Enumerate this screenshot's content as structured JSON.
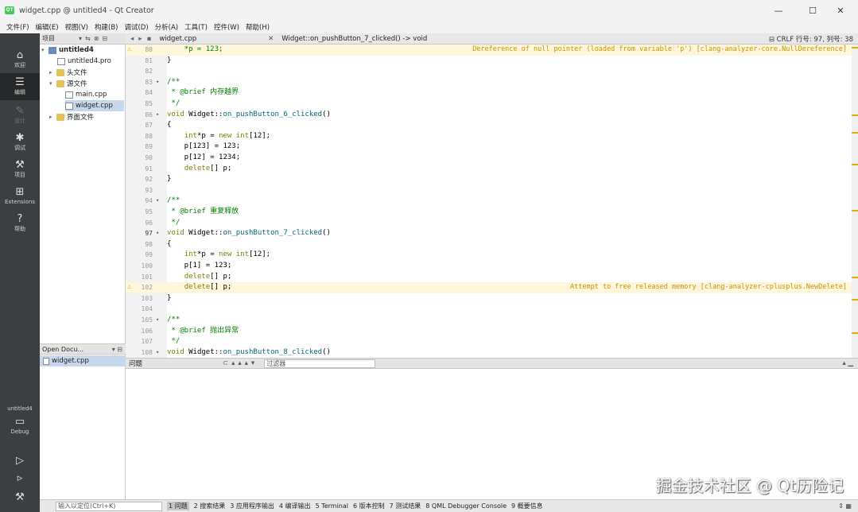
{
  "window": {
    "title": "widget.cpp @ untitled4 - Qt Creator",
    "icon": "QT",
    "minimize": "—",
    "maximize": "☐",
    "close": "✕"
  },
  "menu": [
    "文件(F)",
    "编辑(E)",
    "视图(V)",
    "构建(B)",
    "调试(D)",
    "分析(A)",
    "工具(T)",
    "控件(W)",
    "帮助(H)"
  ],
  "modes": {
    "welcome": "欢迎",
    "edit": "编辑",
    "design": "设计",
    "debug": "调试",
    "projects": "项目",
    "extensions": "Extensions",
    "help": "帮助",
    "kit_project": "untitled4",
    "kit_config": "Debug"
  },
  "project_panel": {
    "combo": "项目",
    "tree": {
      "root": "untitled4",
      "pro": "untitled4.pro",
      "headers": "头文件",
      "sources": "源文件",
      "main": "main.cpp",
      "widget": "widget.cpp",
      "forms": "界面文件"
    }
  },
  "open_documents": {
    "header": "Open Docu...",
    "items": [
      "widget.cpp"
    ]
  },
  "editor_toolbar": {
    "document": "widget.cpp",
    "function": "Widget::on_pushButton_7_clicked() -> void",
    "encoding": "CRLF",
    "position": "行号: 97, 列号: 38"
  },
  "editor": {
    "lines": [
      {
        "n": "80",
        "code": "    *p = 123;",
        "warn": true,
        "annot": "Dereference of null pointer (loaded from variable 'p') [clang-analyzer-core.NullDereference]"
      },
      {
        "n": "81",
        "code": "}"
      },
      {
        "n": "82",
        "code": ""
      },
      {
        "n": "83",
        "code": "/**",
        "fold": true
      },
      {
        "n": "84",
        "code": " * @brief 内存越界"
      },
      {
        "n": "85",
        "code": " */"
      },
      {
        "n": "86",
        "code": "void Widget::on_pushButton_6_clicked()",
        "fold": true
      },
      {
        "n": "87",
        "code": "{"
      },
      {
        "n": "88",
        "code": "    int*p = new int[12];"
      },
      {
        "n": "89",
        "code": "    p[123] = 123;"
      },
      {
        "n": "90",
        "code": "    p[12] = 1234;"
      },
      {
        "n": "91",
        "code": "    delete[] p;"
      },
      {
        "n": "92",
        "code": "}"
      },
      {
        "n": "93",
        "code": ""
      },
      {
        "n": "94",
        "code": "/**",
        "fold": true
      },
      {
        "n": "95",
        "code": " * @brief 重复释放"
      },
      {
        "n": "96",
        "code": " */"
      },
      {
        "n": "97",
        "code": "void Widget::on_pushButton_7_clicked()",
        "fold": true,
        "cur": true
      },
      {
        "n": "98",
        "code": "{"
      },
      {
        "n": "99",
        "code": "    int*p = new int[12];"
      },
      {
        "n": "100",
        "code": "    p[1] = 123;"
      },
      {
        "n": "101",
        "code": "    delete[] p;"
      },
      {
        "n": "102",
        "code": "    delete[] p;",
        "warn": true,
        "annot": "Attempt to free released memory [clang-analyzer-cplusplus.NewDelete]"
      },
      {
        "n": "103",
        "code": "}"
      },
      {
        "n": "104",
        "code": ""
      },
      {
        "n": "105",
        "code": "/**",
        "fold": true
      },
      {
        "n": "106",
        "code": " * @brief 抛出异常"
      },
      {
        "n": "107",
        "code": " */"
      },
      {
        "n": "108",
        "code": "void Widget::on_pushButton_8_clicked()",
        "fold": true
      }
    ]
  },
  "output_pane": {
    "title": "问题",
    "filter_placeholder": "过滤器"
  },
  "watermark": "掘金技术社区 @ Qt历险记",
  "statusbar": {
    "locator_placeholder": "输入以定位(Ctrl+K)",
    "panes": [
      "1 问题",
      "2 搜索结果",
      "3 应用程序输出",
      "4 编译输出",
      "5 Terminal",
      "6 版本控制",
      "7 测试结果",
      "8 QML Debugger Console",
      "9 概要信息"
    ]
  },
  "colors": {
    "modebar": "#3c3f41",
    "warning": "#d8a000",
    "warn_line": "#fff6dc",
    "keyword": "#808000",
    "comment": "#008000"
  }
}
